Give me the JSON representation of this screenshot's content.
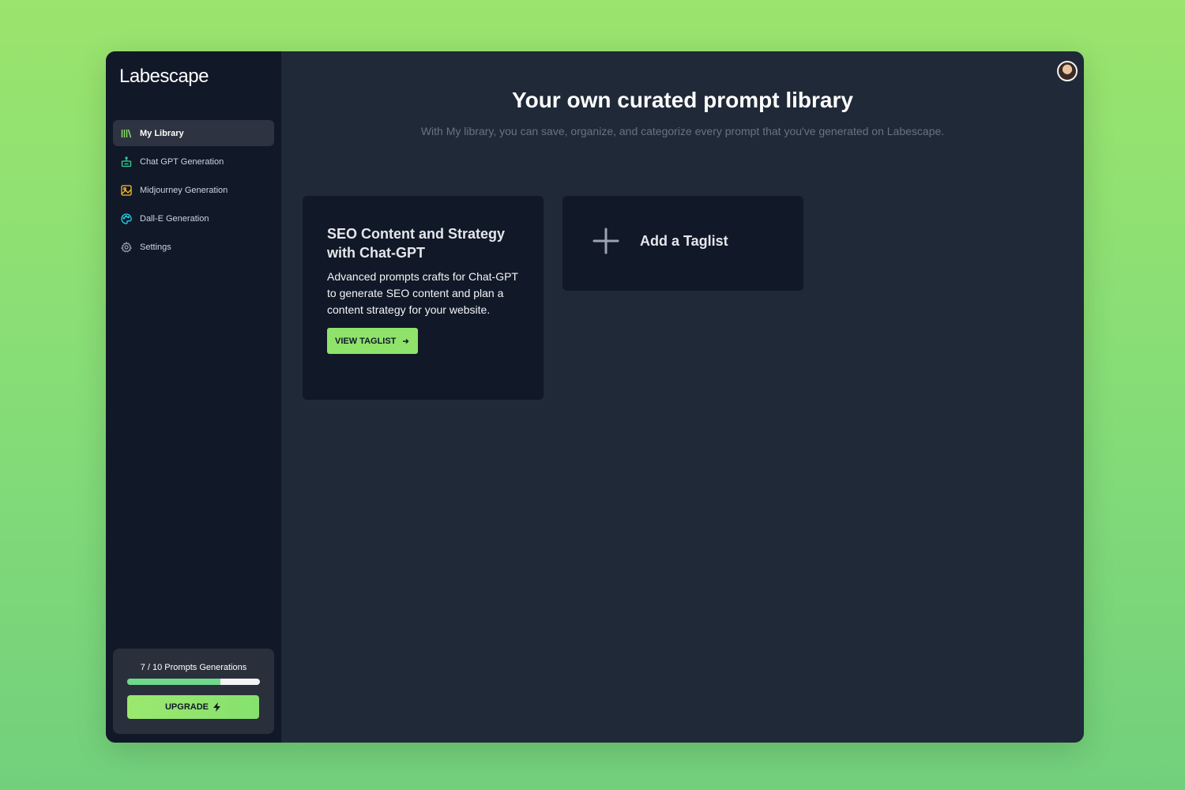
{
  "app": {
    "logo": "Labescape"
  },
  "sidebar": {
    "items": [
      {
        "label": "My Library",
        "icon": "library-icon",
        "active": true
      },
      {
        "label": "Chat GPT Generation",
        "icon": "robot-icon"
      },
      {
        "label": "Midjourney Generation",
        "icon": "image-icon"
      },
      {
        "label": "Dall-E Generation",
        "icon": "palette-icon"
      },
      {
        "label": "Settings",
        "icon": "gear-icon"
      }
    ],
    "usage": {
      "text": "7 / 10 Prompts Generations",
      "used": 7,
      "total": 10,
      "upgrade_label": "UPGRADE"
    }
  },
  "main": {
    "title": "Your own curated prompt library",
    "subtitle": "With My library, you can save, organize, and categorize every prompt that you've generated on Labescape.",
    "cards": [
      {
        "title": "SEO Content and Strategy with Chat-GPT",
        "description": "Advanced prompts crafts for Chat-GPT to generate SEO content and plan a content strategy for your website.",
        "button": "VIEW TAGLIST"
      }
    ],
    "add_card": {
      "label": "Add a Taglist"
    }
  },
  "colors": {
    "accent": "#8fe36b",
    "sidebar": "#111827",
    "main": "#1f2937"
  }
}
